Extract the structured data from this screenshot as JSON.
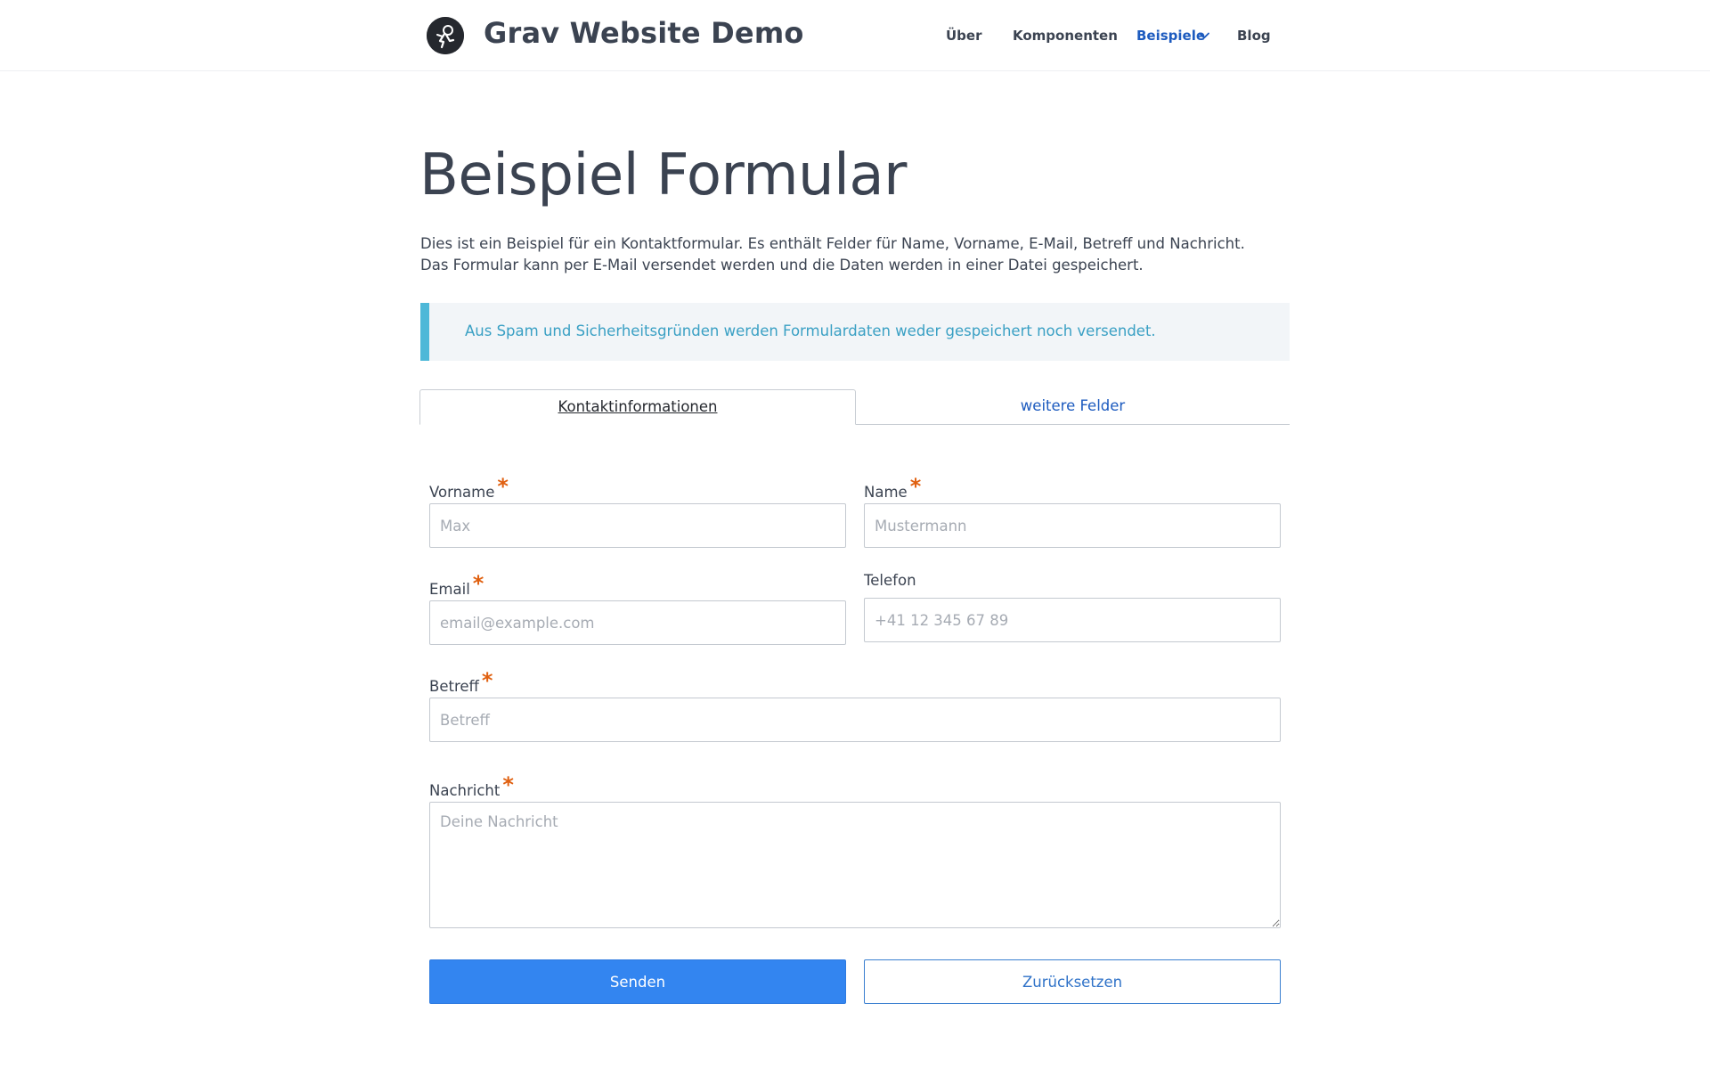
{
  "header": {
    "site_title": "Grav Website Demo",
    "logo_icon": "astronaut-logo-icon",
    "nav": [
      {
        "label": "Über",
        "active": false
      },
      {
        "label": "Komponenten",
        "active": false
      },
      {
        "label": "Beispiele",
        "active": true,
        "has_dropdown": true
      },
      {
        "label": "Blog",
        "active": false
      }
    ]
  },
  "main": {
    "title": "Beispiel Formular",
    "intro": "Dies ist ein Beispiel für ein Kontaktformular. Es enthält Felder für Name, Vorname, E-Mail, Betreff und Nachricht. Das Formular kann per E-Mail versendet werden und die Daten werden in einer Datei gespeichert.",
    "notice": "Aus Spam und Sicherheitsgründen werden Formulardaten weder gespeichert noch versendet.",
    "tabs": [
      {
        "label": "Kontaktinformationen",
        "active": true
      },
      {
        "label": "weitere Felder",
        "active": false
      }
    ]
  },
  "form": {
    "required_marker": "*",
    "fields": {
      "vorname": {
        "label": "Vorname",
        "placeholder": "Max",
        "value": "",
        "required": true
      },
      "name": {
        "label": "Name",
        "placeholder": "Mustermann",
        "value": "",
        "required": true
      },
      "email": {
        "label": "Email",
        "placeholder": "email@example.com",
        "value": "",
        "required": true
      },
      "telefon": {
        "label": "Telefon",
        "placeholder": "+41 12 345 67 89",
        "value": "",
        "required": false
      },
      "betreff": {
        "label": "Betreff",
        "placeholder": "Betreff",
        "value": "",
        "required": true
      },
      "nachricht": {
        "label": "Nachricht",
        "placeholder": "Deine Nachricht",
        "value": "",
        "required": true
      }
    },
    "buttons": {
      "submit": "Senden",
      "reset": "Zurücksetzen"
    }
  },
  "colors": {
    "accent": "#1d5bbf",
    "primary_button": "#3385f0",
    "notice_border": "#4db8d8",
    "notice_text": "#3aa0c4",
    "required": "#e06010"
  }
}
